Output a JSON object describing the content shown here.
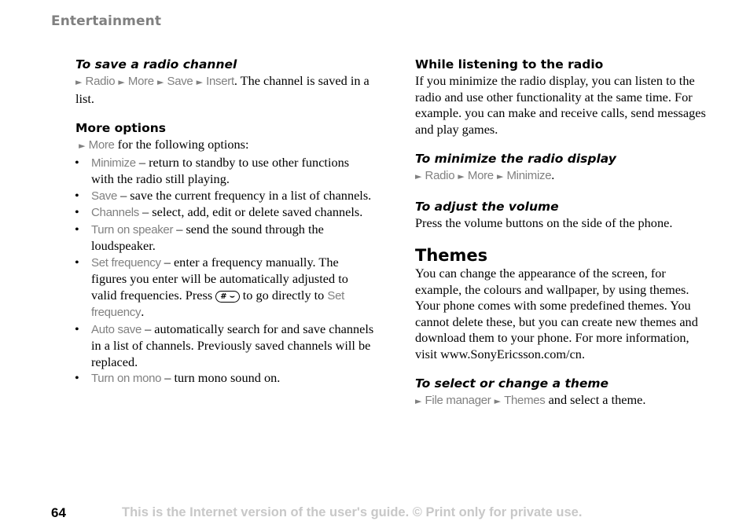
{
  "header": {
    "section": "Entertainment"
  },
  "left": {
    "save_channel": {
      "title": "To save a radio channel",
      "path": [
        "Radio",
        "More",
        "Save",
        "Insert"
      ],
      "text_after": ". The channel is saved in a list."
    },
    "more_options": {
      "title": "More options",
      "intro_menu": "More",
      "intro_text": " for the following options:",
      "items": [
        {
          "term": "Minimize",
          "desc": " – return to standby to use other functions with the radio still playing."
        },
        {
          "term": "Save",
          "desc": " – save the current frequency in a list of channels."
        },
        {
          "term": "Channels",
          "desc": " – select, add, edit or delete saved channels."
        },
        {
          "term": "Turn on speaker",
          "desc": " – send the sound through the loudspeaker."
        },
        {
          "term": "Set frequency",
          "desc": " – enter a frequency manually. The figures you enter will be automatically adjusted to valid frequencies. Press ",
          "key": "# ⌣",
          "desc2": " to go directly to ",
          "term2": "Set frequency",
          "desc3": "."
        },
        {
          "term": "Auto save",
          "desc": " – automatically search for and save channels in a list of channels. Previously saved channels will be replaced."
        },
        {
          "term": "Turn on mono",
          "desc": " – turn mono sound on."
        }
      ]
    }
  },
  "right": {
    "listening": {
      "title": "While listening to the radio",
      "text": "If you minimize the radio display, you can listen to the radio and use other functionality at the same time. For example. you can make and receive calls, send messages and play games."
    },
    "minimize": {
      "title": "To minimize the radio display",
      "path": [
        "Radio",
        "More",
        "Minimize"
      ],
      "text_after": "."
    },
    "volume": {
      "title": "To adjust the volume",
      "text": "Press the volume buttons on the side of the phone."
    },
    "themes": {
      "title": "Themes",
      "text": "You can change the appearance of the screen, for example, the colours and wallpaper, by using themes. Your phone comes with some predefined themes. You cannot delete these, but you can create new themes and download them to your phone. For more information, visit www.SonyEricsson.com/cn."
    },
    "select_theme": {
      "title": "To select or change a theme",
      "path": [
        "File manager",
        "Themes"
      ],
      "text_after": " and select a theme."
    }
  },
  "footer": {
    "page_number": "64",
    "note": "This is the Internet version of the user's guide. © Print only for private use."
  },
  "icons": {
    "menu_arrow": "►",
    "bullet": "•"
  }
}
